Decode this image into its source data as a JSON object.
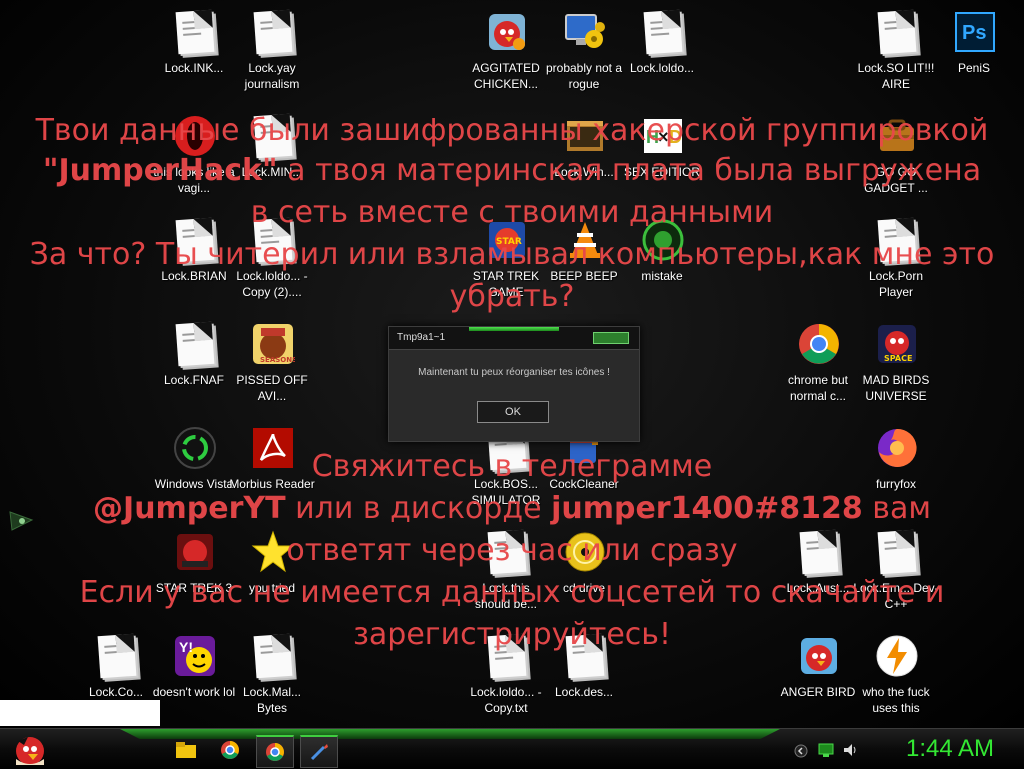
{
  "ransom": {
    "line1": "Твои данные были зашифрованны хакерской группировкой",
    "line2_brand": "\"JumperHack\"",
    "line2_rest": " а твоя материнская плата была выгружена",
    "line3": "в сеть вместе с твоими данными",
    "line4": "За что? Ты читерил или взламывал компьютеры,как мне это",
    "line5": "убрать?",
    "line6": "Свяжитесь в телеграмме",
    "line7_handle": "@JumperYT",
    "line7_mid": " или в дискорде ",
    "line7_discord": "jumper1400#8128",
    "line7_end": " вам",
    "line8": "ответят через час или сразу",
    "line9": "Если у вас не имеется данных соцсетей то скачайте и",
    "line10": "зарегистрируйтесь!"
  },
  "icons": [
    {
      "label": "Lock.INK...",
      "icon": "text-file-icon"
    },
    {
      "label": "Lock.yay journalism",
      "icon": "text-file-icon"
    },
    {
      "label": "AGGITATED CHICKEN...",
      "icon": "angry-bird-icon"
    },
    {
      "label": "probably not a rogue",
      "icon": "monitor-gears-icon"
    },
    {
      "label": "Lock.loldo...",
      "icon": "text-file-icon"
    },
    {
      "label": "Lock.SO LIT!!! AIRE",
      "icon": "text-file-icon"
    },
    {
      "label": "PeniS",
      "icon": "photoshop-icon"
    },
    {
      "label": "this looks like a vagi...",
      "icon": "opera-icon"
    },
    {
      "label": "Lock.MIN...",
      "icon": "text-file-icon"
    },
    {
      "label": "Lock.Win...",
      "icon": "window-icon"
    },
    {
      "label": "SEX EDITIOR",
      "icon": "hxd-icon"
    },
    {
      "label": "GO GO GADGET ...",
      "icon": "briefcase-icon"
    },
    {
      "label": "Lock.BRIAN",
      "icon": "text-file-icon"
    },
    {
      "label": "Lock.loldo... - Copy (2)....",
      "icon": "text-file-icon"
    },
    {
      "label": "STAR TREK GAME",
      "icon": "star-wars-game-icon"
    },
    {
      "label": "BEEP BEEP",
      "icon": "vlc-icon"
    },
    {
      "label": "mistake",
      "icon": "green-orb-icon"
    },
    {
      "label": "Lock.Porn Player",
      "icon": "text-file-icon"
    },
    {
      "label": "Lock.FNAF",
      "icon": "text-file-icon"
    },
    {
      "label": "PISSED OFF AVI...",
      "icon": "angry-birds-seasons-icon"
    },
    {
      "label": "chrome but normal c...",
      "icon": "chrome-icon"
    },
    {
      "label": "MAD BIRDS UNIVERSE",
      "icon": "angry-birds-space-icon"
    },
    {
      "label": "Windows Vista",
      "icon": "recycle-icon"
    },
    {
      "label": "Morbius Reader",
      "icon": "acrobat-icon"
    },
    {
      "label": "Lock.BOS... SIMULATOR",
      "icon": "text-file-icon"
    },
    {
      "label": "CockCleaner",
      "icon": "ccleaner-icon"
    },
    {
      "label": "furryfox",
      "icon": "firefox-icon"
    },
    {
      "label": "STAR TREK 3",
      "icon": "star-wars-game-icon"
    },
    {
      "label": "you tried",
      "icon": "star-icon"
    },
    {
      "label": "Lock.this should be...",
      "icon": "text-file-icon"
    },
    {
      "label": "cd drive",
      "icon": "cd-icon"
    },
    {
      "label": "Lock.Aust...",
      "icon": "text-file-icon"
    },
    {
      "label": "Lock.Em... Dev-C++",
      "icon": "text-file-icon"
    },
    {
      "label": "Lock.Co...",
      "icon": "text-file-icon"
    },
    {
      "label": "doesn't work lol",
      "icon": "yahoo-messenger-icon"
    },
    {
      "label": "Lock.Mal... Bytes",
      "icon": "text-file-icon"
    },
    {
      "label": "Lock.loldo... - Copy.txt",
      "icon": "text-file-icon"
    },
    {
      "label": "Lock.des...",
      "icon": "text-file-icon"
    },
    {
      "label": "ANGER BIRD",
      "icon": "angry-bird-icon"
    },
    {
      "label": "who the fuck uses this",
      "icon": "winamp-icon"
    }
  ],
  "dialog": {
    "title": "Tmp9a1~1",
    "message": "Maintenant tu peux réorganiser tes icônes !",
    "ok_label": "OK"
  },
  "taskbar": {
    "clock": "1:44 AM",
    "items": [
      "file-explorer-icon",
      "chrome-icon",
      "chrome-icon",
      "pen-tool-icon"
    ]
  },
  "colors": {
    "ransom_text": "#e8484a",
    "accent_green": "#33e833",
    "taskbar_bg": "#0b0b0b"
  }
}
